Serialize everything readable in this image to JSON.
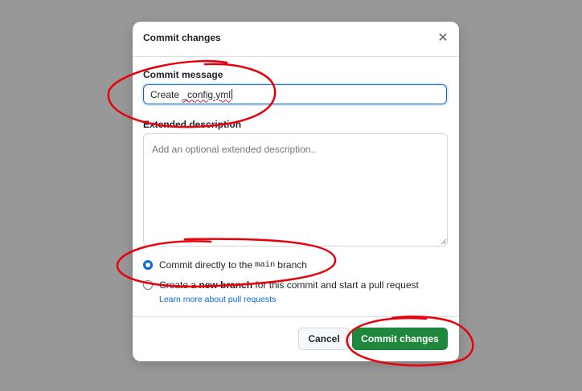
{
  "dialog": {
    "title": "Commit changes",
    "close_icon": "close-icon"
  },
  "form": {
    "message_label": "Commit message",
    "message_prefix": "Create ",
    "message_filename": "_config.yml",
    "description_label": "Extended description",
    "description_placeholder": "Add an optional extended description.."
  },
  "branch_options": {
    "direct_pre": "Commit directly to the",
    "direct_branch": "main",
    "direct_post": "branch",
    "new_branch_pre": "Create a",
    "new_branch_bold": "new branch",
    "new_branch_post": "for this commit and start a pull request",
    "learn_more": "Learn more about pull requests",
    "selected": "direct"
  },
  "footer": {
    "cancel_label": "Cancel",
    "commit_label": "Commit changes"
  },
  "colors": {
    "primary_button": "#1f883d",
    "focus_blue": "#0969da",
    "annotation_red": "#e8000b"
  }
}
